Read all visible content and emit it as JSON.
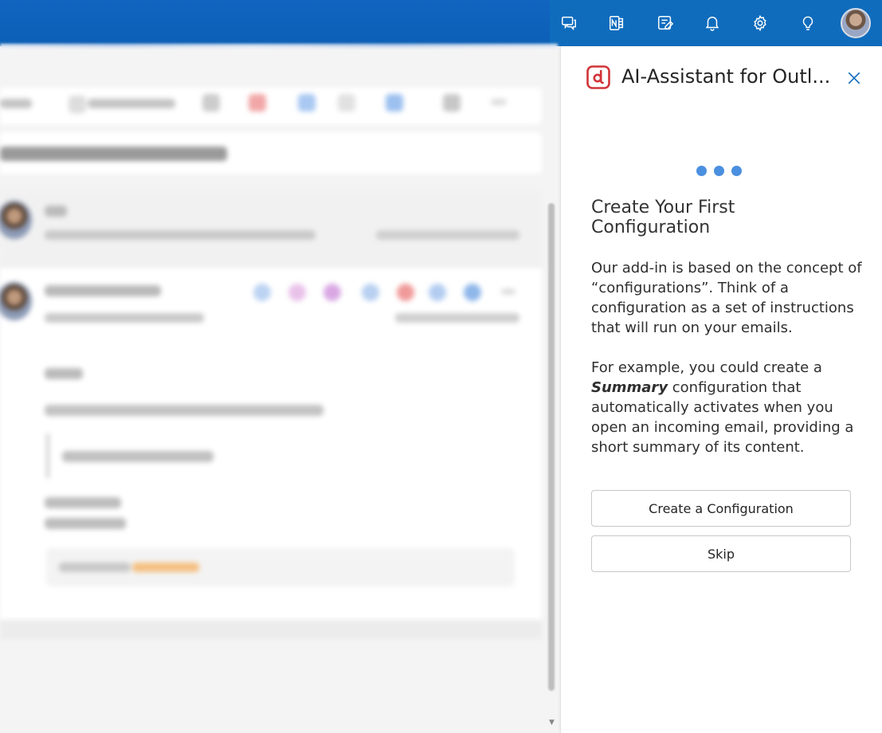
{
  "topbar": {
    "icons": [
      {
        "name": "chat-icon"
      },
      {
        "name": "onenote-icon"
      },
      {
        "name": "tasks-icon"
      },
      {
        "name": "bell-icon"
      },
      {
        "name": "gear-icon"
      },
      {
        "name": "lightbulb-icon"
      }
    ],
    "brand_color": "#0f6cbd"
  },
  "panel": {
    "title": "AI-Assistant for Outl...",
    "heading": "Create Your First Configuration",
    "paragraph1": "Our add-in is based on the concept of “configurations”. Think of a configuration as a set of instructions that will run on your emails.",
    "paragraph2_prefix": "For example, you could create a",
    "paragraph2_emphasis": "Summary",
    "paragraph2_suffix": " configuration that automatically activates when you open an incoming email, providing a short summary of its content.",
    "create_button": "Create a Configuration",
    "skip_button": "Skip",
    "loading_dot_color": "#4a8fe0",
    "logo_color": "#d13438"
  }
}
